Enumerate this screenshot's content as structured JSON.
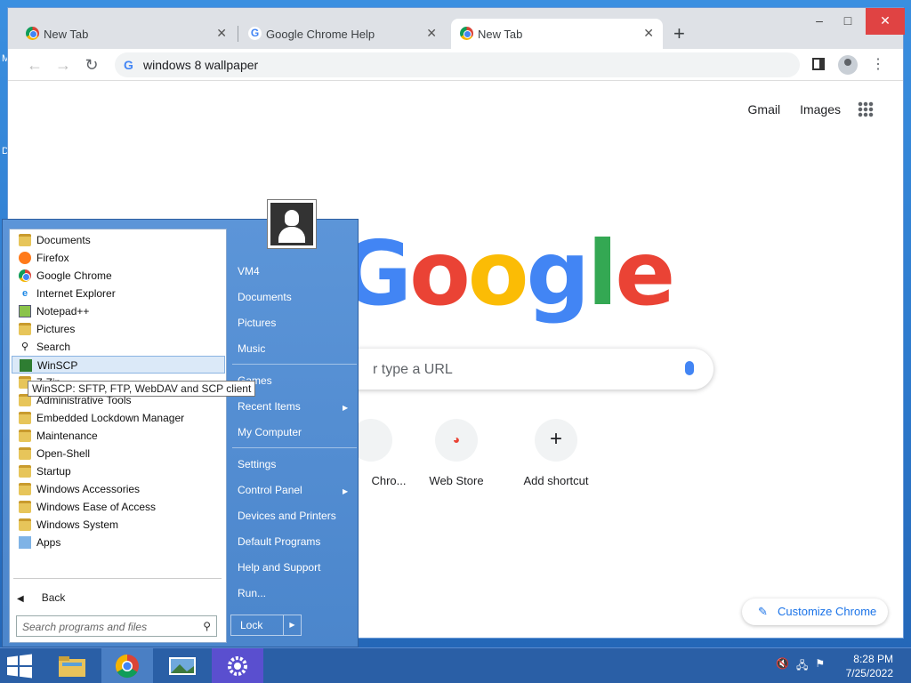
{
  "desktop": {
    "edge_label_1": "M",
    "edge_label_2": "D"
  },
  "browser": {
    "tabs": [
      {
        "label": "New Tab",
        "icon": "chrome-icon"
      },
      {
        "label": "Google Chrome Help",
        "icon": "google-g-icon"
      },
      {
        "label": "New Tab",
        "icon": "chrome-icon",
        "active": true
      }
    ],
    "new_tab": "+",
    "controls": {
      "minimize": "–",
      "maximize": "□",
      "close": "✕"
    },
    "omnibox": {
      "value": "windows 8 wallpaper",
      "icon": "google-g-icon"
    },
    "ntp": {
      "links": [
        "Gmail",
        "Images"
      ],
      "logo_letters": [
        "G",
        "o",
        "o",
        "g",
        "l",
        "e"
      ],
      "logo_colors": [
        "#4285f4",
        "#ea4335",
        "#fbbc05",
        "#4285f4",
        "#34a853",
        "#ea4335"
      ],
      "search_placeholder": "Search Google or type a URL",
      "search_placeholder_visible": "r type a URL",
      "shortcuts": [
        {
          "label": "Google Chro...",
          "visible_label": "Chro...",
          "icon": "google-g-icon"
        },
        {
          "label": "Web Store",
          "icon": "chrome-web-store-icon"
        },
        {
          "label": "Add shortcut",
          "icon": "plus-icon"
        }
      ],
      "customize": "Customize Chrome"
    }
  },
  "start_menu": {
    "programs": [
      {
        "label": "Documents",
        "icon": "folder-icon"
      },
      {
        "label": "Firefox",
        "icon": "firefox-icon"
      },
      {
        "label": "Google Chrome",
        "icon": "chrome-icon"
      },
      {
        "label": "Internet Explorer",
        "icon": "ie-icon"
      },
      {
        "label": "Notepad++",
        "icon": "notepad-icon"
      },
      {
        "label": "Pictures",
        "icon": "folder-icon"
      },
      {
        "label": "Search",
        "icon": "search-icon"
      },
      {
        "label": "WinSCP",
        "icon": "winscp-icon",
        "selected": true
      },
      {
        "label": "7-Zip",
        "icon": "folder-icon"
      },
      {
        "label": "Administrative Tools",
        "icon": "folder-icon"
      },
      {
        "label": "Embedded Lockdown Manager",
        "icon": "folder-icon"
      },
      {
        "label": "Maintenance",
        "icon": "folder-icon"
      },
      {
        "label": "Open-Shell",
        "icon": "folder-icon"
      },
      {
        "label": "Startup",
        "icon": "folder-icon"
      },
      {
        "label": "Windows Accessories",
        "icon": "folder-icon"
      },
      {
        "label": "Windows Ease of Access",
        "icon": "folder-icon"
      },
      {
        "label": "Windows System",
        "icon": "folder-icon"
      },
      {
        "label": "Apps",
        "icon": "apps-folder-icon"
      }
    ],
    "back": "Back",
    "search_placeholder": "Search programs and files",
    "tooltip": "WinSCP: SFTP, FTP, WebDAV and SCP client",
    "places": [
      {
        "label": "VM4"
      },
      {
        "label": "Documents"
      },
      {
        "label": "Pictures"
      },
      {
        "label": "Music"
      },
      {
        "label": "Games"
      },
      {
        "label": "Recent Items",
        "submenu": true
      },
      {
        "label": "My Computer"
      },
      {
        "label": "Settings"
      },
      {
        "label": "Control Panel",
        "submenu": true
      },
      {
        "label": "Devices and Printers"
      },
      {
        "label": "Default Programs"
      },
      {
        "label": "Help and Support"
      },
      {
        "label": "Run..."
      }
    ],
    "lock": "Lock"
  },
  "taskbar": {
    "items": [
      "file-explorer-icon",
      "chrome-icon",
      "photos-icon",
      "settings-gear-icon"
    ],
    "tray": [
      "volume-muted-icon",
      "network-icon",
      "action-center-icon"
    ],
    "time": "8:28 PM",
    "date": "7/25/2022"
  }
}
